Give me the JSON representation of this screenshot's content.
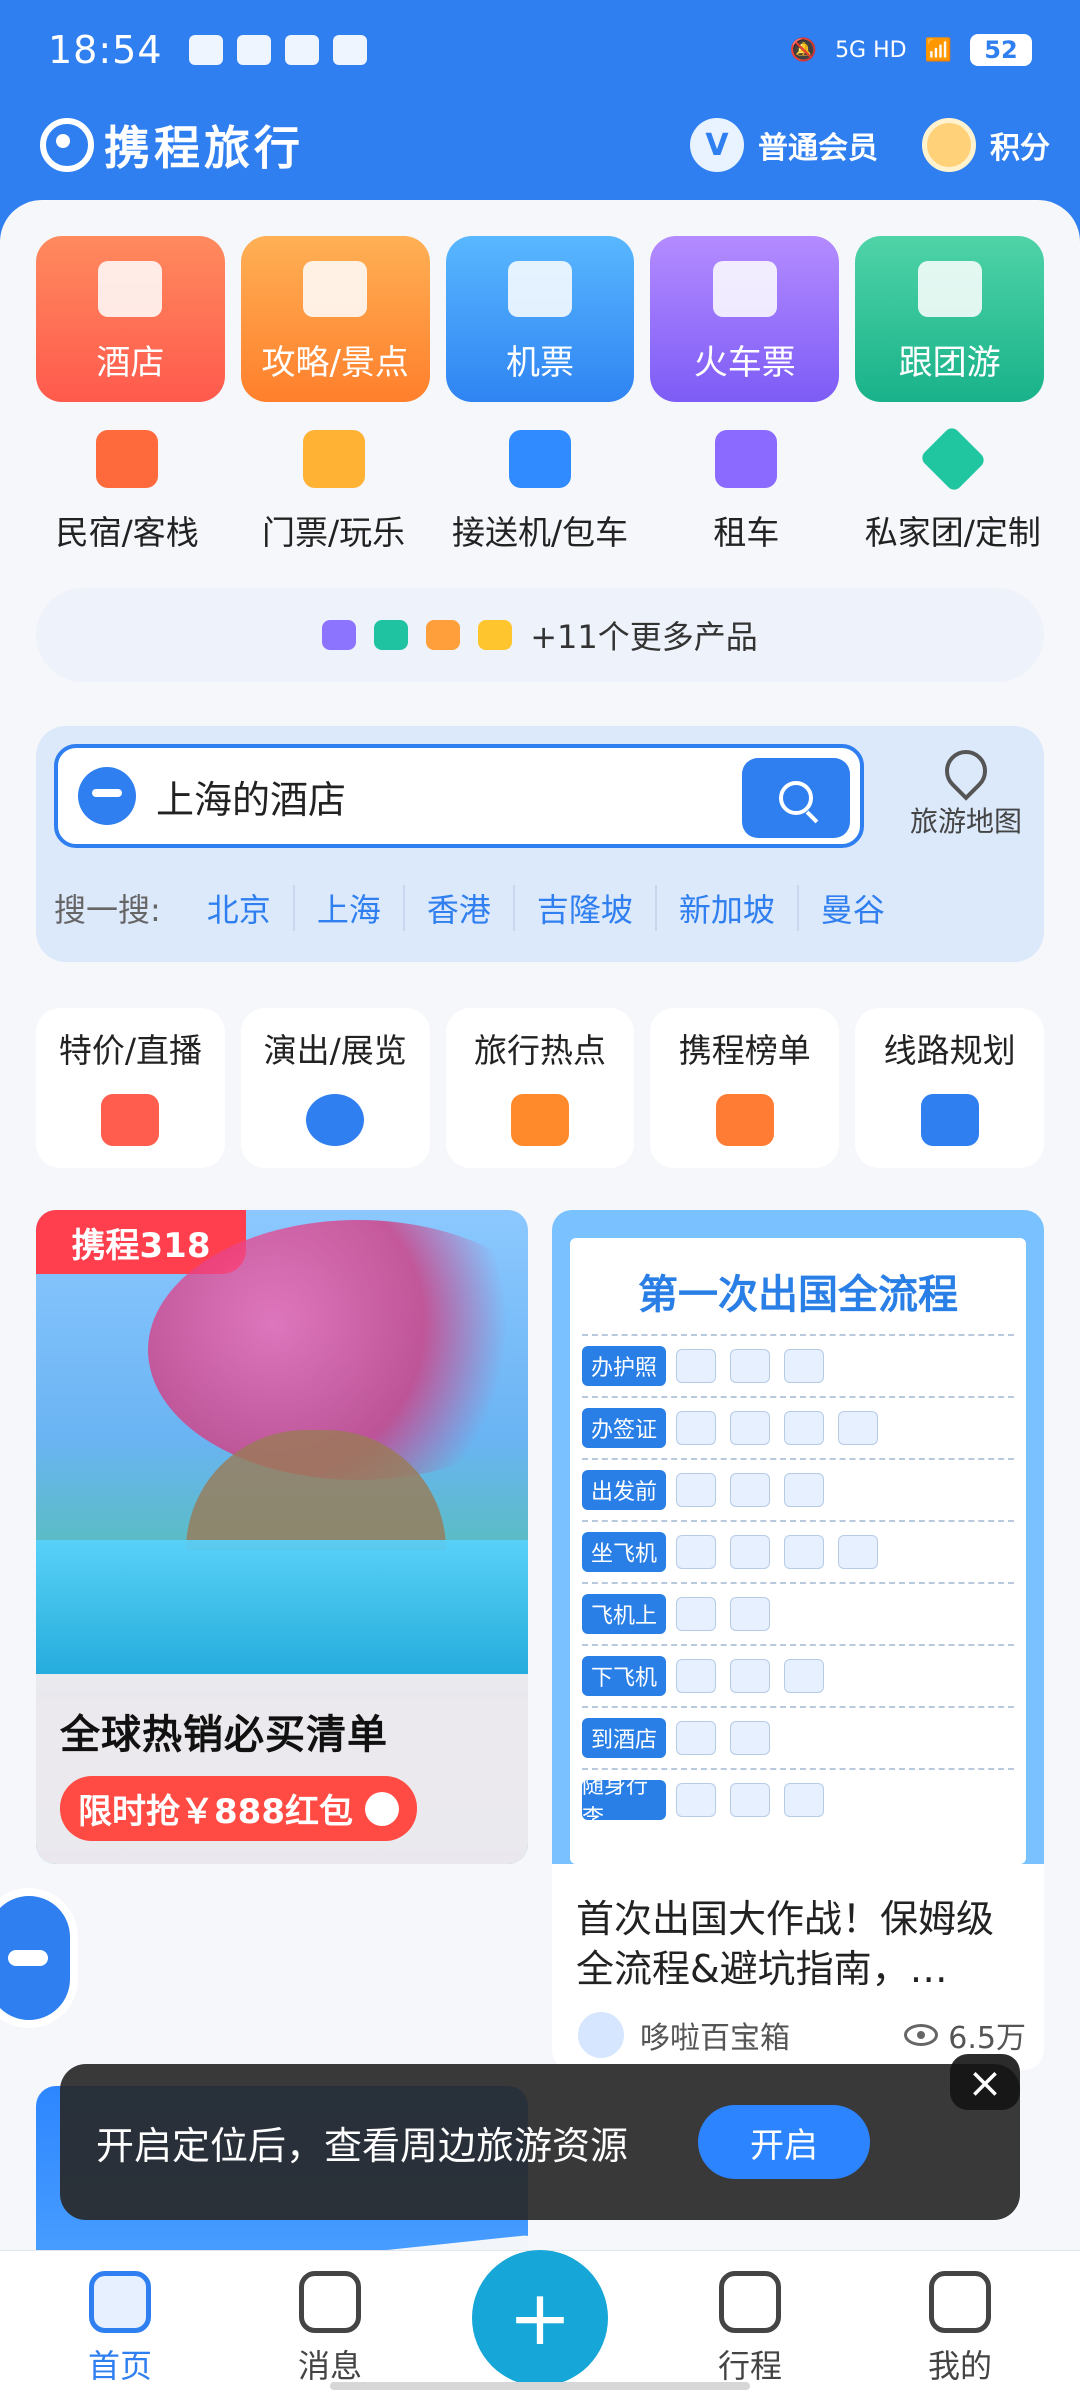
{
  "status_bar": {
    "time": "18:54",
    "battery": "52",
    "signal_label": "5G HD"
  },
  "brand": {
    "name": "携程旅行",
    "member_icon": "V",
    "member_label": "普通会员",
    "points_label": "积分"
  },
  "big_tiles": [
    {
      "label": "酒店"
    },
    {
      "label": "攻略/景点"
    },
    {
      "label": "机票"
    },
    {
      "label": "火车票"
    },
    {
      "label": "跟团游"
    }
  ],
  "small_items": [
    {
      "label": "民宿/客栈"
    },
    {
      "label": "门票/玩乐"
    },
    {
      "label": "接送机/包车"
    },
    {
      "label": "租车"
    },
    {
      "label": "私家团/定制"
    }
  ],
  "more_products": "+11个更多产品",
  "search": {
    "text": "上海的酒店",
    "map_label": "旅游地图",
    "hot_label": "搜一搜:",
    "hot_items": [
      "北京",
      "上海",
      "香港",
      "吉隆坡",
      "新加坡",
      "曼谷"
    ]
  },
  "feature_tiles": [
    {
      "label": "特价/直播"
    },
    {
      "label": "演出/展览"
    },
    {
      "label": "旅行热点"
    },
    {
      "label": "携程榜单"
    },
    {
      "label": "线路规划"
    }
  ],
  "card_left": {
    "tag": "携程318",
    "title": "全球热销必买清单",
    "promo": "限时抢￥888红包"
  },
  "card_right": {
    "sheet_title": "第一次出国全流程",
    "rows": [
      "办护照",
      "办签证",
      "出发前",
      "坐飞机",
      "飞机上",
      "下飞机",
      "到酒店",
      "随身行李"
    ],
    "title": "首次出国大作战！保姆级全流程&避坑指南，…",
    "author": "哆啦百宝箱",
    "views": "6.5万"
  },
  "toast": {
    "text": "开启定位后，查看周边旅游资源",
    "button": "开启",
    "close": "×"
  },
  "tabbar": {
    "items": [
      {
        "label": "首页"
      },
      {
        "label": "消息"
      },
      {
        "label": "行程"
      },
      {
        "label": "我的"
      }
    ],
    "plus": "+"
  }
}
